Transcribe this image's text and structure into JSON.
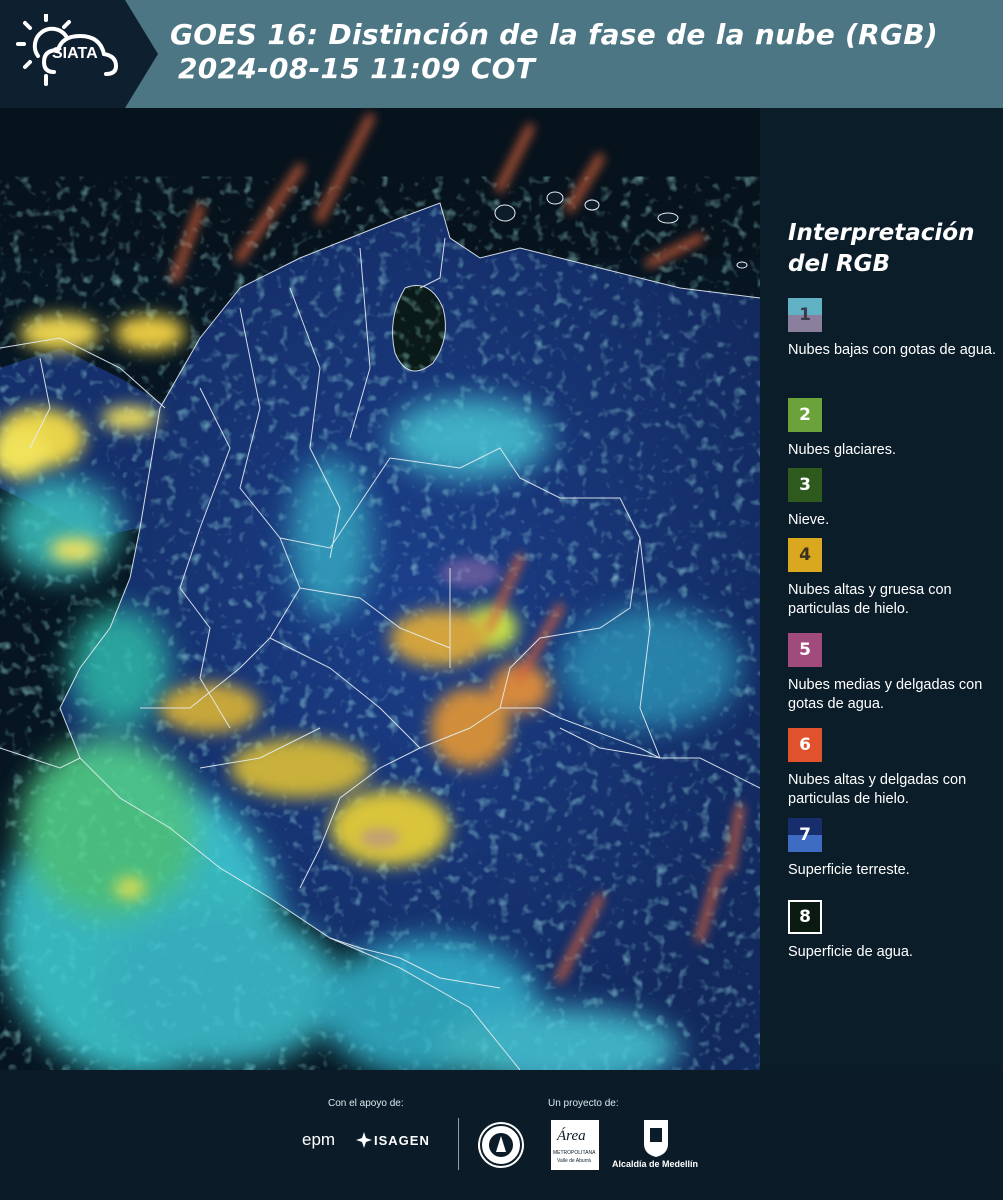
{
  "header": {
    "logo_text": "SIATA",
    "title_line1": "GOES 16: Distinción de la fase de la nube (RGB)",
    "title_line2": "2024-08-15 11:09 COT"
  },
  "legend": {
    "title_line1": "Interpretación",
    "title_line2": "del RGB",
    "items": [
      {
        "num": "1",
        "top_color": "#5fb1c3",
        "bottom_color": "#8a7f9c",
        "text_color": "#3a3a4a",
        "label": "Nubes bajas con gotas de agua."
      },
      {
        "num": "2",
        "top_color": "#6ba33a",
        "bottom_color": "#6ba33a",
        "text_color": "#ffffff",
        "label": "Nubes glaciares."
      },
      {
        "num": "3",
        "top_color": "#2f5a1e",
        "bottom_color": "#2f5a1e",
        "text_color": "#ffffff",
        "label": "Nieve."
      },
      {
        "num": "4",
        "top_color": "#d9a81e",
        "bottom_color": "#d9a81e",
        "text_color": "#3a3220",
        "label": "Nubes altas y gruesa con particulas de hielo."
      },
      {
        "num": "5",
        "top_color": "#a14a7c",
        "bottom_color": "#a14a7c",
        "text_color": "#ffffff",
        "label": "Nubes medias y delgadas con gotas de agua."
      },
      {
        "num": "6",
        "top_color": "#e0522c",
        "bottom_color": "#e0522c",
        "text_color": "#ffffff",
        "label": "Nubes altas y delgadas con particulas de hielo."
      },
      {
        "num": "7",
        "top_color": "#182e6c",
        "bottom_color": "#3d6cc2",
        "text_color": "#ffffff",
        "label": "Superficie terreste."
      },
      {
        "num": "8",
        "top_color": "#0a1a10",
        "bottom_color": "#0a1a10",
        "text_color": "#ffffff",
        "label": "Superficie de agua."
      }
    ]
  },
  "footer": {
    "support_label": "Con el apoyo de:",
    "project_label": "Un proyecto de:",
    "sponsor_epm": "epm",
    "sponsor_isagen": "ISAGEN",
    "area_name": "Área",
    "area_sub1": "METROPOLITANA",
    "area_sub2": "Valle de Aburrá",
    "alcaldia": "Alcaldía de Medellín"
  }
}
